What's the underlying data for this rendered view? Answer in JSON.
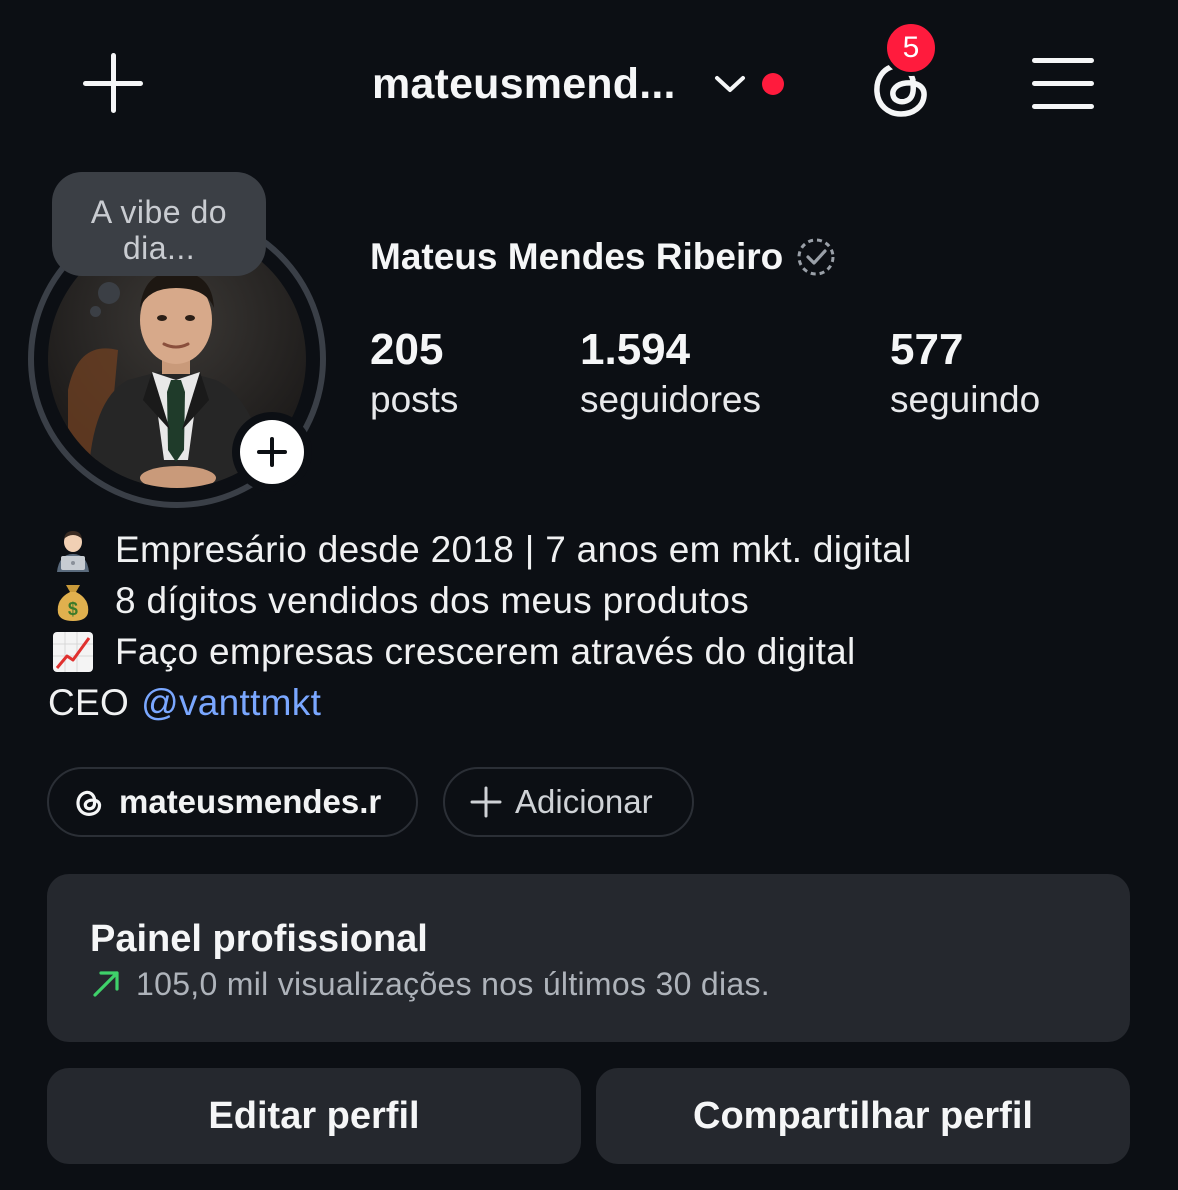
{
  "header": {
    "username": "mateusmend...",
    "notification_count": "5"
  },
  "profile": {
    "note": "A vibe do dia...",
    "full_name": "Mateus Mendes Ribeiro"
  },
  "stats": [
    {
      "value": "205",
      "label": "posts"
    },
    {
      "value": "1.594",
      "label": "seguidores"
    },
    {
      "value": "577",
      "label": "seguindo"
    }
  ],
  "bio": {
    "line1_emoji": "👨🏻‍💻",
    "line1": "Empresário desde 2018 | 7 anos em mkt. digital",
    "line2_emoji": "💰",
    "line2": "8 dígitos vendidos dos meus produtos",
    "line3_emoji": "📈",
    "line3": "Faço empresas crescerem através do digital",
    "line4_prefix": "CEO",
    "line4_mention": "@vanttmkt"
  },
  "links": {
    "threads_handle": "mateusmendes.r",
    "add_label": "Adicionar"
  },
  "panel": {
    "title": "Painel profissional",
    "subtitle": "105,0 mil visualizações nos últimos 30 dias."
  },
  "buttons": {
    "edit": "Editar perfil",
    "share": "Compartilhar perfil"
  },
  "colors": {
    "background": "#0c0f14",
    "card": "#25282e",
    "accent_red": "#ff1b3d",
    "mention_blue": "#7aa7ff",
    "trend_green": "#3fd16a"
  },
  "icons": [
    "plus-icon",
    "chevron-down-icon",
    "threads-icon",
    "hamburger-menu-icon",
    "verified-badge-icon",
    "add-story-plus-icon",
    "trend-up-icon"
  ]
}
